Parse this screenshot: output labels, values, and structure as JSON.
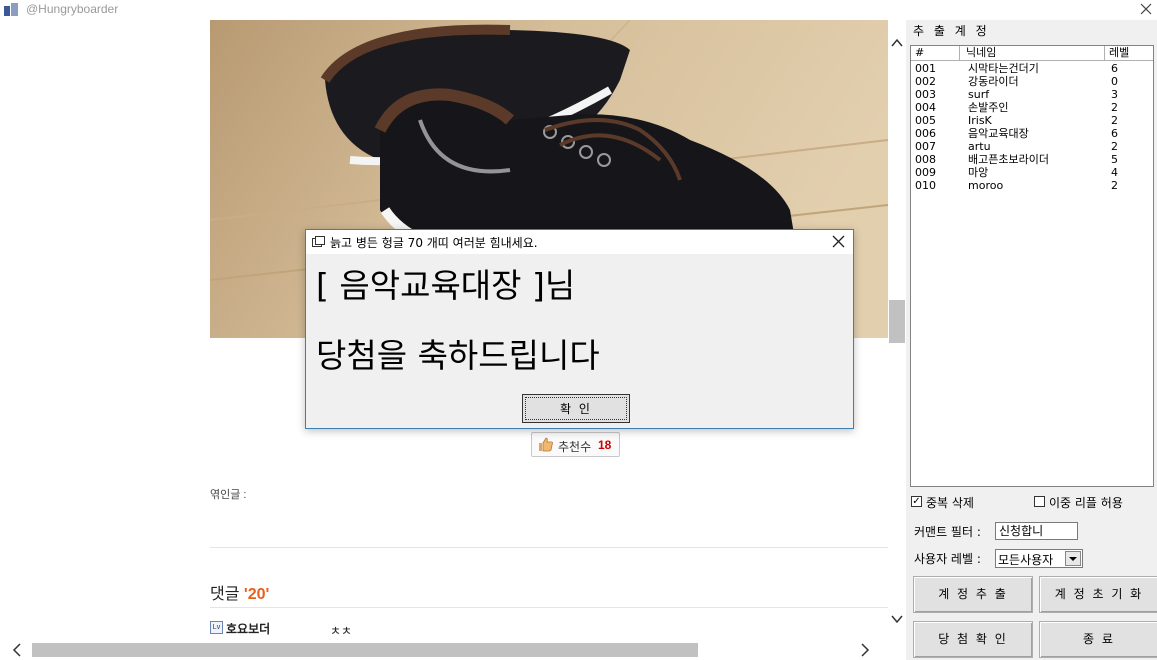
{
  "window": {
    "title": "@Hungryboarder"
  },
  "post": {
    "recommend_label": "추천수",
    "recommend_count": "18",
    "linked_label": "엮인글 :",
    "comments_label": "댓글",
    "comments_count": "'20'",
    "comment": {
      "author": "호요보더",
      "text": "ㅊㅊ"
    }
  },
  "panel": {
    "title": "추 출 계 정",
    "columns": [
      "#",
      "닉네임",
      "레벨"
    ],
    "accounts": [
      {
        "num": "001",
        "nick": "시막타는건더기",
        "level": "6"
      },
      {
        "num": "002",
        "nick": "강동라이더",
        "level": "0"
      },
      {
        "num": "003",
        "nick": "surf",
        "level": "3"
      },
      {
        "num": "004",
        "nick": "손발주인",
        "level": "2"
      },
      {
        "num": "005",
        "nick": "IrisK",
        "level": "2"
      },
      {
        "num": "006",
        "nick": "음악교육대장",
        "level": "6"
      },
      {
        "num": "007",
        "nick": "artu",
        "level": "2"
      },
      {
        "num": "008",
        "nick": "배고픈초보라이더",
        "level": "5"
      },
      {
        "num": "009",
        "nick": "마앙",
        "level": "4"
      },
      {
        "num": "010",
        "nick": "moroo",
        "level": "2"
      }
    ],
    "dedupe_label": "중복 삭제",
    "dedupe_checked": true,
    "double_reply_label": "이중 리플 허용",
    "double_reply_checked": false,
    "filter_label": "커맨트 필터 :",
    "filter_value": "신청합니",
    "level_label": "사용자 레벨 :",
    "level_value": "모든사용자",
    "btn_extract": "계 정 추 출",
    "btn_reset": "계 정 초 기 화",
    "btn_confirm": "당 첨 확 인",
    "btn_exit": "종 료"
  },
  "dialog": {
    "title": "늙고 병든 헝글 70 개띠 여러분 힘내세요.",
    "line1": "[ 음악교육대장 ]님",
    "line2": "당첨을 축하드립니다",
    "ok_label": "확 인"
  },
  "colors": {
    "accent_orange": "#e8601c",
    "recommend_red": "#cc0000",
    "dialog_border": "#3c7fb1"
  }
}
